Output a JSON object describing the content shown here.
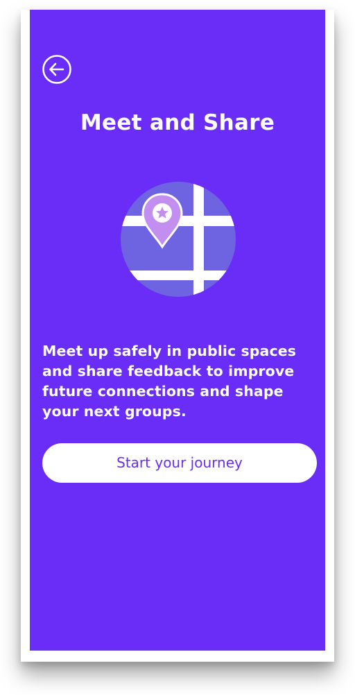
{
  "screen": {
    "title": "Meet and Share",
    "description": "Meet up safely in public spaces and share feedback to improve future connections and shape your next groups.",
    "cta_label": "Start your journey"
  },
  "icons": {
    "back": "arrow-left-circle-icon",
    "illustration": "map-pin-star-illustration"
  },
  "colors": {
    "background": "#6a2cf7",
    "map_fill": "#6e63e0",
    "pin": "#c28ef0",
    "button_bg": "#ffffff",
    "button_text": "#6a2cf7"
  }
}
